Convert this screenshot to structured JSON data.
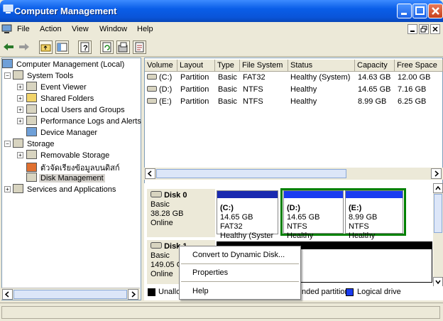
{
  "window": {
    "title": "Computer Management"
  },
  "menubar": [
    "File",
    "Action",
    "View",
    "Window",
    "Help"
  ],
  "tree": {
    "root": "Computer Management (Local)",
    "system_tools": "System Tools",
    "event_viewer": "Event Viewer",
    "shared_folders": "Shared Folders",
    "local_users": "Local Users and Groups",
    "perf_logs": "Performance Logs and Alerts",
    "device_manager": "Device Manager",
    "storage": "Storage",
    "removable_storage": "Removable Storage",
    "defrag": "ตัวจัดเรียงข้อมูลบนดิสก์",
    "disk_management": "Disk Management",
    "services": "Services and Applications"
  },
  "volume_table": {
    "columns": [
      "Volume",
      "Layout",
      "Type",
      "File System",
      "Status",
      "Capacity",
      "Free Space"
    ],
    "rows": [
      [
        "(C:)",
        "Partition",
        "Basic",
        "FAT32",
        "Healthy (System)",
        "14.63 GB",
        "12.00 GB"
      ],
      [
        "(D:)",
        "Partition",
        "Basic",
        "NTFS",
        "Healthy",
        "14.65 GB",
        "7.16 GB"
      ],
      [
        "(E:)",
        "Partition",
        "Basic",
        "NTFS",
        "Healthy",
        "8.99 GB",
        "6.25 GB"
      ]
    ]
  },
  "disks": {
    "disk0": {
      "name": "Disk 0",
      "type": "Basic",
      "size": "38.28 GB",
      "status": "Online"
    },
    "disk1": {
      "name": "Disk 1",
      "type": "Basic",
      "size": "149.05 G",
      "status": "Online"
    }
  },
  "partitions": {
    "c": {
      "label": "(C:)",
      "info": "14.65 GB FAT32",
      "status": "Healthy (Syster"
    },
    "d": {
      "label": "(D:)",
      "info": "14.65 GB NTFS",
      "status": "Healthy"
    },
    "e": {
      "label": "(E:)",
      "info": "8.99 GB NTFS",
      "status": "Healthy"
    }
  },
  "legend": {
    "unallocated": "Unallo",
    "extended": "nded partition",
    "logical": "Logical drive"
  },
  "context_menu": {
    "convert": "Convert to Dynamic Disk...",
    "properties": "Properties",
    "help": "Help"
  },
  "colors": {
    "titlebar": "#0a5ee8",
    "primary_partition": "#1a2ab0",
    "logical_drive": "#1a3cf0",
    "selection": "#008000"
  }
}
